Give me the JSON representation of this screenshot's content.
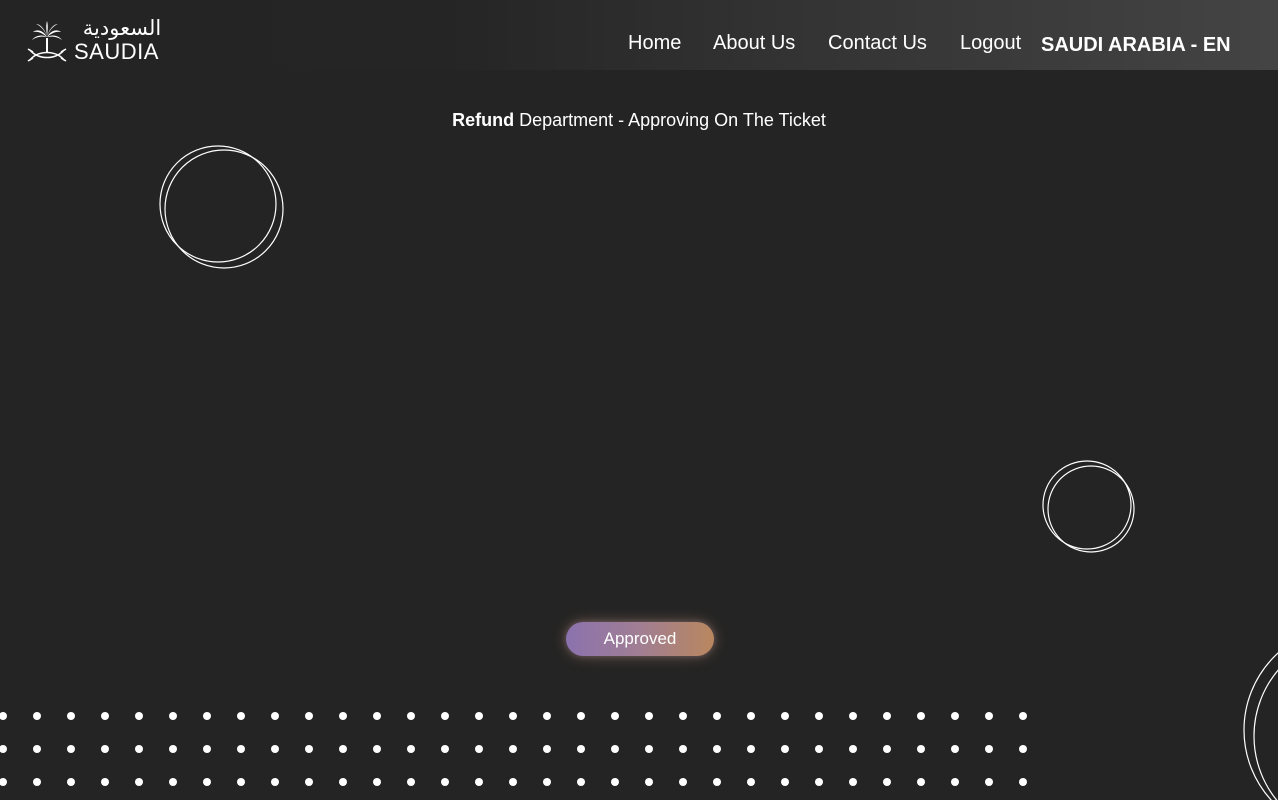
{
  "header": {
    "logo": {
      "arabic": "السعودية",
      "latin": "SAUDIA",
      "emblem_icon": "palm-swords-emblem-icon"
    },
    "nav": {
      "home": "Home",
      "about": "About Us",
      "contact": "Contact Us",
      "logout": "Logout"
    },
    "region": "SAUDI ARABIA - EN"
  },
  "main": {
    "title_bold": "Refund",
    "title_rest": " Department - Approving On The Ticket",
    "status_button": "Approved"
  },
  "colors": {
    "background": "#242424",
    "text": "#ffffff",
    "button_gradient_start": "#8b72ae",
    "button_gradient_end": "#b9875e"
  }
}
